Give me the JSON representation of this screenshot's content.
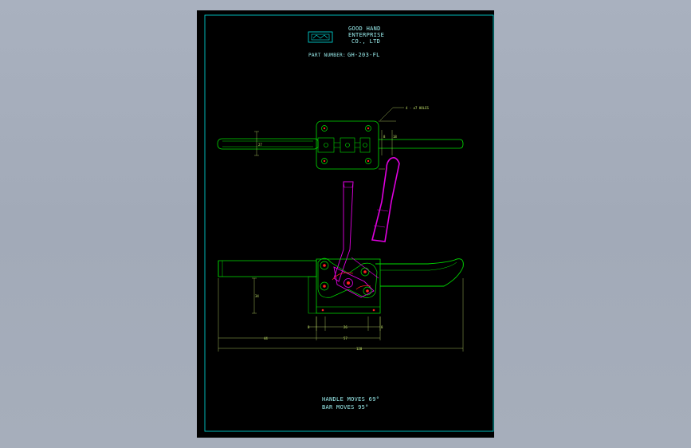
{
  "company": {
    "line1": "GOOD HAND",
    "line2": "ENTERPRISE",
    "line3": "CO., LTD"
  },
  "part": {
    "label": "PART NUMBER:",
    "number": "GH-203-FL"
  },
  "annotation": {
    "holes": "4 - ∅7 HOLES"
  },
  "dimensions": {
    "d_small_1": "8",
    "d_small_2": "18",
    "d_small_3": "27",
    "d_vert": "34",
    "d_mid": "26",
    "d_right": "8",
    "d_left": "8",
    "d_base_left": "44",
    "d_base_right": "57",
    "d_total": "120"
  },
  "notes": {
    "handle": "HANDLE  MOVES  69°",
    "bar": "BAR      MOVES  95°"
  },
  "colors": {
    "frame": "#00e5e5",
    "outline": "#00e000",
    "handle": "#e000e0",
    "holes": "#ff2020",
    "text": "#9cf0f0",
    "dim": "#c8e86c"
  }
}
